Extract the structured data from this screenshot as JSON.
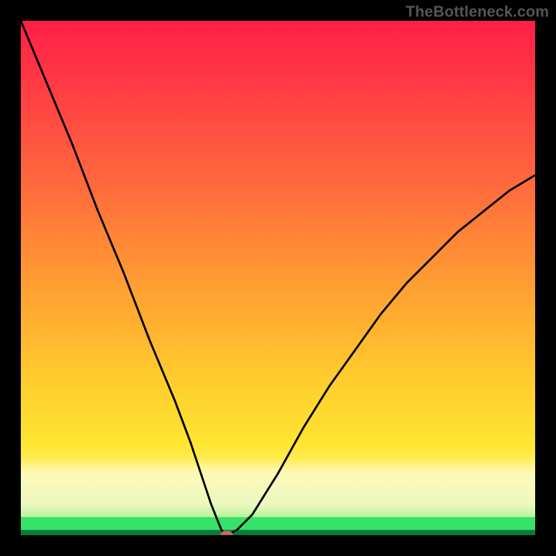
{
  "watermark": "TheBottleneck.com",
  "chart_data": {
    "type": "line",
    "title": "",
    "xlabel": "",
    "ylabel": "",
    "xlim": [
      0,
      100
    ],
    "ylim": [
      0,
      100
    ],
    "x": [
      0,
      5,
      10,
      15,
      20,
      25,
      30,
      33,
      35,
      37,
      39,
      40,
      42,
      45,
      50,
      55,
      60,
      65,
      70,
      75,
      80,
      85,
      90,
      95,
      100
    ],
    "y": [
      100,
      88,
      76,
      63,
      51,
      38,
      26,
      18,
      12,
      6,
      1,
      0,
      1,
      4,
      12,
      21,
      29,
      36,
      43,
      49,
      54,
      59,
      63,
      67,
      70
    ],
    "series_name": "bottleneck_curve",
    "background_gradient_stops": [
      {
        "pos": 0.0,
        "color": "#ff1f47"
      },
      {
        "pos": 0.5,
        "color": "#ff9a33"
      },
      {
        "pos": 0.82,
        "color": "#ffe531"
      },
      {
        "pos": 0.92,
        "color": "#fdf9b8"
      },
      {
        "pos": 0.965,
        "color": "#37e26a"
      },
      {
        "pos": 0.99,
        "color": "#0a7a3a"
      }
    ],
    "marker": {
      "x": 40,
      "y": 0,
      "color": "#bc6a5e"
    }
  }
}
